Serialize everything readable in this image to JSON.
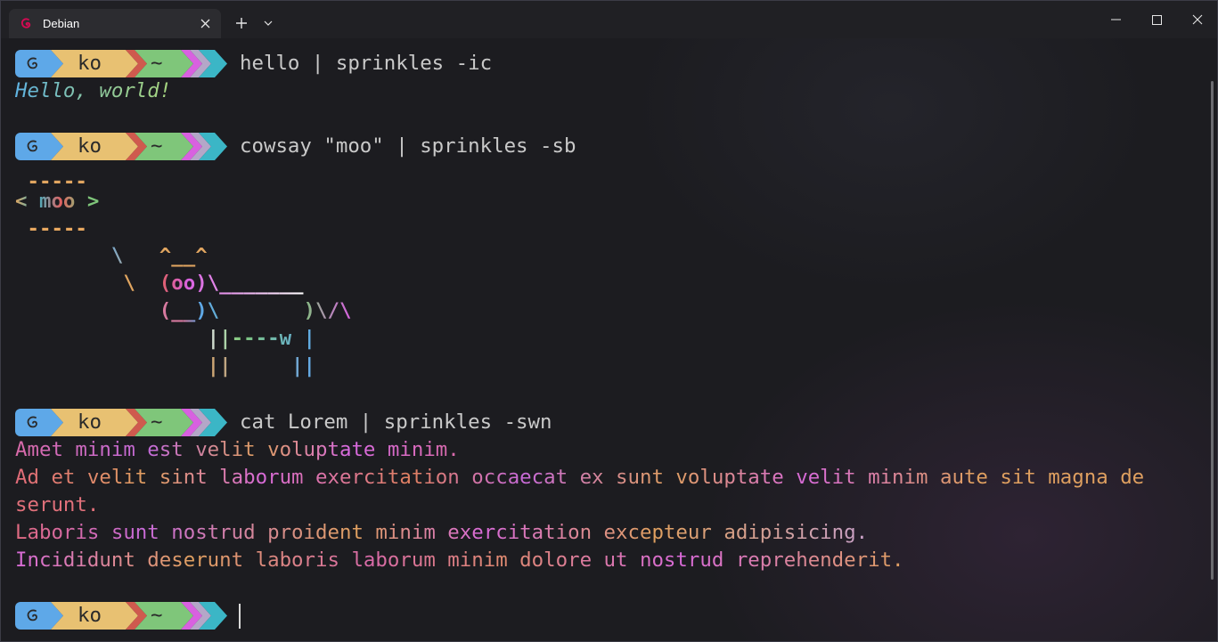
{
  "window": {
    "tab_title": "Debian",
    "new_tab_label": "+",
    "tab_dropdown_icon": "chevron-down-icon",
    "tab_icon": "debian-swirl-icon"
  },
  "colors": {
    "seg_os": "#5ea8e8",
    "seg_user": "#e8c172",
    "seg_git": "#cf5a4e",
    "seg_path": "#7fc67a",
    "seg_arrow_pink": "#d861e0",
    "seg_arrow_lilac": "#b4a7c8",
    "seg_arrow_teal": "#3bb6c6"
  },
  "prompt": {
    "user": "ko",
    "path": "~",
    "os_icon": "debian-swirl-icon"
  },
  "session": {
    "cmd1": "hello | sprinkles -ic",
    "out1": "Hello, world!",
    "cmd2": "cowsay \"moo\" | sprinkles -sb",
    "cow_top": " -----",
    "cow_moo": "< moo >",
    "cow_bottom": " -----",
    "cow_l1": "        \\   ^__^",
    "cow_l2": "         \\  (oo)\\_______",
    "cow_l3": "            (__)\\       )\\/\\",
    "cow_l4": "                ||----w |",
    "cow_l5": "                ||     ||",
    "cmd3": "cat Lorem | sprinkles -swn",
    "lorem1": "Amet minim est velit voluptate minim.",
    "lorem2": "Ad et velit sint laborum exercitation occaecat ex sunt voluptate velit minim aute sit magna de",
    "lorem3": "serunt.",
    "lorem4": "Laboris sunt nostrud proident minim exercitation excepteur adipisicing.",
    "lorem5": "Incididunt deserunt laboris laborum minim dolore ut nostrud reprehenderit."
  }
}
